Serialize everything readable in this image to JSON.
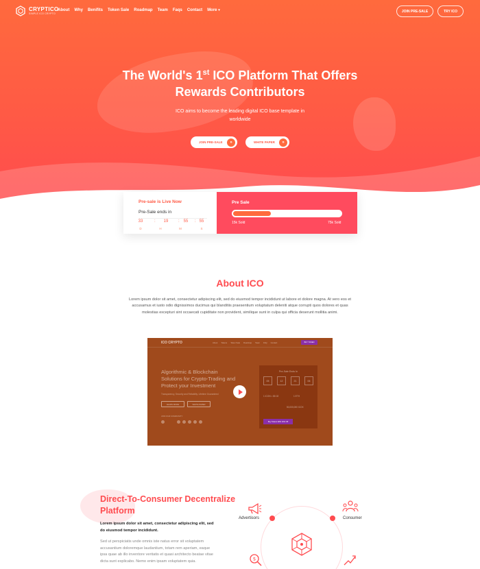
{
  "nav": {
    "logo_name": "CRYPTICO",
    "logo_tagline": "SIMPLE ICO CRYPTO",
    "items": [
      "About",
      "Why",
      "Benifits",
      "Token Sale",
      "Roadmap",
      "Team",
      "Faqs",
      "Contact",
      "More"
    ],
    "join_presale": "JOIN PRE-SALE",
    "try_ico": "TRY ICO"
  },
  "hero": {
    "title_line1_a": "The World's 1",
    "title_sup": "st",
    "title_line1_b": " ICO Platform That Offers",
    "title_line2": "Rewards Contributors",
    "subtitle": "ICO aims to become the leading digital ICO base template in worldwide",
    "btn_join": "JOIN PRE-SALE",
    "btn_white": "WHITE PAPER"
  },
  "presale": {
    "live": "Pre-sale is Live Now",
    "ends": "Pre-Sale ends in",
    "countdown": [
      {
        "value": "33",
        "unit": "D"
      },
      {
        "value": "19",
        "unit": "H"
      },
      {
        "value": "55",
        "unit": "M"
      },
      {
        "value": "55",
        "unit": "S"
      }
    ],
    "title": "Pre Sale",
    "progress": 0.35,
    "sold_label": "15k Sold",
    "total_label": "75k Sold"
  },
  "about": {
    "title": "About ICO",
    "text": "Lorem ipsum dolor sit amet, consectetur adipiscing elit, sed do eiusmod tempor incididunt ut labore et dolore magna. At vero eos et accusamus et iusto odio dignissimos ducimus qui blanditiis praesentium voluptatum deleniti atque corrupti quos dolores et quas molestias excepturi sint occaecati cupiditate non provident, similique sunt in culpa qui officia deserunt mollitia animi."
  },
  "video": {
    "logo": "ICO CRYPTO",
    "nav": [
      "About",
      "Tokens",
      "Token Sale",
      "Roadmap",
      "Team",
      "FAQ",
      "Contact"
    ],
    "buy_btn": "BUY TOKEN",
    "headline": "Algorithmic & Blockchain Solutions for Crypto-Trading and Protect your Investment",
    "sub": "Transparency, Security and Reliability. Lifetime Guaranteed",
    "btn_learn": "LEARN MORE",
    "btn_white": "WHITE PAPER",
    "join": "JOIN OUR COMMUNITY",
    "panel_title": "Pre-Sale Ends In",
    "panel_boxes": [
      "05",
      "12",
      "21",
      "06"
    ],
    "panel_token": "1 ICON = $0.02",
    "panel_eth": "1 ETH",
    "panel_supply": "50,000,000 ICOX",
    "panel_btn": "Buy Tokens With 40% Off"
  },
  "dc": {
    "title": "Direct-To-Consumer Decentralize Platform",
    "bold": "Lorem ipsum dolor sit amet, consectetur adipiscing elit, sed do eiusmod tempor incididunt.",
    "text": "Sed ut perspiciatis unde omnis iste natus error sit voluptatem accusantium doloremque laudantium, totam rem aperiam, eaque ipsa quae ab illo inventore veritatis et quasi architecto beatae vitae dicta sunt explicabo. Nemo enim ipsam voluptatem quia.",
    "advertisors": "Advertisors",
    "consumer": "Consumer"
  },
  "colors": {
    "accent": "#ff4b4f",
    "orange": "#ff6a3d"
  }
}
